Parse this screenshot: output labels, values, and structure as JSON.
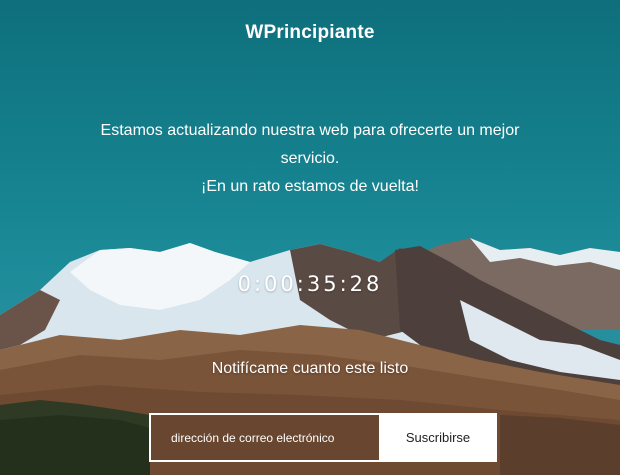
{
  "site": {
    "title": "WPrincipiante"
  },
  "message": {
    "line1": "Estamos actualizando nuestra web para ofrecerte un mejor servicio.",
    "line2": "¡En un rato estamos de vuelta!"
  },
  "countdown": {
    "display": "0:00:35:28"
  },
  "subscribe": {
    "label": "Notifícame cuanto este listo",
    "email_placeholder": "dirección de correo electrónico",
    "button_label": "Suscribirse"
  },
  "colors": {
    "sky": "#147e8b",
    "text": "#ffffff",
    "button_bg": "#ffffff",
    "button_text": "#222222"
  }
}
